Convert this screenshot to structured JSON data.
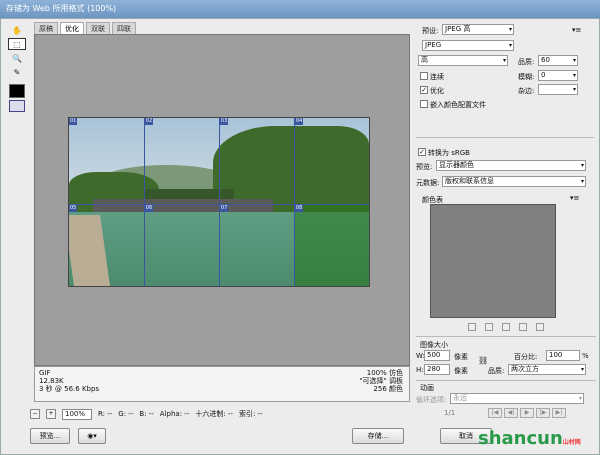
{
  "window": {
    "title": "存储为 Web 所用格式 (100%)"
  },
  "tabs": [
    "原稿",
    "优化",
    "双联",
    "四联"
  ],
  "active_tab": 1,
  "slices": {
    "top": [
      "01",
      "02",
      "03",
      "04"
    ],
    "bottom": [
      "05",
      "06",
      "07",
      "08"
    ]
  },
  "info": {
    "format": "GIF",
    "size": "12.83K",
    "time": "3 秒 @ 56.6 Kbps",
    "dither_pct": "100% 仿色",
    "palette": "\"可选择\" 调板",
    "colors": "256 颜色"
  },
  "statusbar": {
    "zoom": "100%",
    "r": "R: --",
    "g": "G: --",
    "b": "B: --",
    "alpha": "Alpha: --",
    "hex": "十六进制: --",
    "index": "索引: --"
  },
  "buttons": {
    "preview": "预览...",
    "save": "存储...",
    "cancel": "取消"
  },
  "settings": {
    "preset_label": "预设:",
    "preset_value": "JPEG 高",
    "format_value": "JPEG",
    "quality_level": "高",
    "quality_label": "品质:",
    "quality_value": "60",
    "blur_label": "模糊:",
    "blur_value": "0",
    "matte_label": "杂边:",
    "progressive": "连续",
    "optimized": "优化",
    "embed_profile": "嵌入颜色配置文件",
    "convert_srgb": "转换为 sRGB",
    "preview_label": "预览:",
    "preview_value": "显示器颜色",
    "metadata_label": "元数据:",
    "metadata_value": "版权和联系信息"
  },
  "checkboxes": {
    "progressive": false,
    "optimized": true,
    "embed_profile": false,
    "convert_srgb": true
  },
  "color_table": {
    "title": "颜色表"
  },
  "image_size": {
    "title": "图像大小",
    "w_label": "W:",
    "w_value": "500",
    "h_label": "H:",
    "h_value": "280",
    "unit": "像素",
    "percent_label": "百分比:",
    "percent_value": "100",
    "percent_unit": "%",
    "quality_label": "品质:",
    "quality_value": "两次立方"
  },
  "animation": {
    "title": "动画",
    "loop_label": "循环选项:",
    "loop_value": "永远",
    "frame": "1/1"
  },
  "watermark": {
    "text": "shancun",
    "sub": "山村网"
  }
}
